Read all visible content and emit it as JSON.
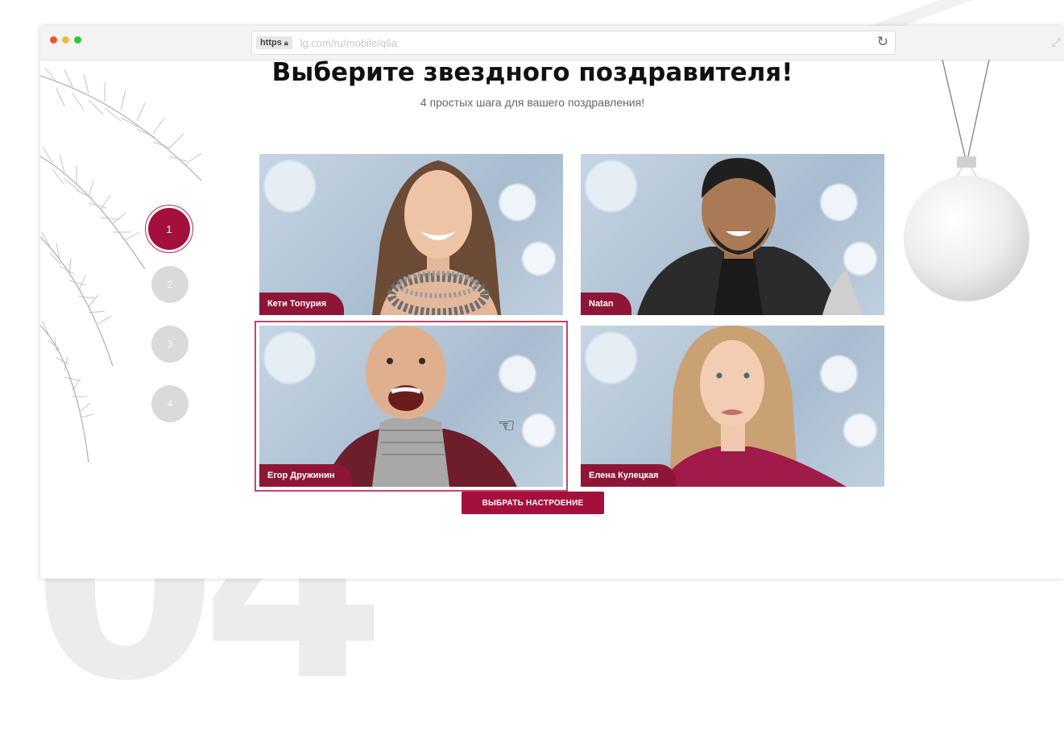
{
  "browser": {
    "protocol": "https",
    "url": "lg.com/ru/mobile/q6a",
    "dots": [
      "#e8562a",
      "#f4b73a",
      "#28c840"
    ]
  },
  "decor": {
    "big_number": "04"
  },
  "page": {
    "title": "Выберите звездного поздравителя!",
    "subtitle": "4 простых шага для вашего поздравления!"
  },
  "steps": [
    {
      "label": "1",
      "active": true
    },
    {
      "label": "2",
      "active": false
    },
    {
      "label": "3",
      "active": false
    },
    {
      "label": "4",
      "active": false
    }
  ],
  "celebrities": [
    {
      "name": "Кети Топурия",
      "selected": false
    },
    {
      "name": "Natan",
      "selected": false
    },
    {
      "name": "Егор Дружинин",
      "selected": true
    },
    {
      "name": "Елена Кулецкая",
      "selected": false
    }
  ],
  "cta": {
    "label": "ВЫБРАТЬ НАСТРОЕНИЕ"
  },
  "colors": {
    "accent": "#a50f3c",
    "tag": "#8f1538",
    "step_inactive": "#dadada"
  }
}
